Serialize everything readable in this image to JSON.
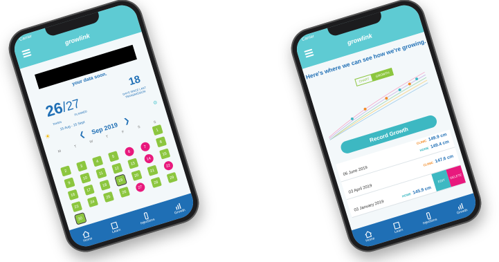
{
  "left_phone": {
    "status": {
      "carrier": "Carrier",
      "time": "",
      "battery": ""
    },
    "logo": "growlink",
    "message": "your data soon.",
    "taken": "26",
    "planned": "27",
    "taken_label": "TAKEN",
    "planned_label": "PLANNED",
    "days_since": "18",
    "days_since_label": "DAYS SINCE LAST TRANSMISSION",
    "range": "15 Aug - 15 Sept",
    "month": "Sep 2019",
    "weekdays": [
      "M",
      "T",
      "W",
      "T",
      "F",
      "S",
      "S"
    ],
    "nav": [
      "Home",
      "Learn",
      "Injections",
      "Growth"
    ]
  },
  "calendar_days": [
    {
      "d": "",
      "s": "e"
    },
    {
      "d": "",
      "s": "e"
    },
    {
      "d": "",
      "s": "e"
    },
    {
      "d": "",
      "s": "e"
    },
    {
      "d": "",
      "s": "e"
    },
    {
      "d": "",
      "s": "e"
    },
    {
      "d": "1",
      "s": "g"
    },
    {
      "d": "2",
      "s": "g"
    },
    {
      "d": "3",
      "s": "g"
    },
    {
      "d": "4",
      "s": "g"
    },
    {
      "d": "5",
      "s": "g"
    },
    {
      "d": "6",
      "s": "p"
    },
    {
      "d": "7",
      "s": "p"
    },
    {
      "d": "8",
      "s": "g"
    },
    {
      "d": "9",
      "s": "g"
    },
    {
      "d": "10",
      "s": "g"
    },
    {
      "d": "11",
      "s": "g"
    },
    {
      "d": "12",
      "s": "g"
    },
    {
      "d": "13",
      "s": "g"
    },
    {
      "d": "14",
      "s": "p"
    },
    {
      "d": "15",
      "s": "g"
    },
    {
      "d": "16",
      "s": "g"
    },
    {
      "d": "17",
      "s": "g"
    },
    {
      "d": "18",
      "s": "g"
    },
    {
      "d": "19",
      "s": "g"
    },
    {
      "d": "20",
      "s": "g"
    },
    {
      "d": "21",
      "s": "g"
    },
    {
      "d": "22",
      "s": "p"
    },
    {
      "d": "23",
      "s": "g"
    },
    {
      "d": "24",
      "s": "g"
    },
    {
      "d": "25",
      "s": "g"
    },
    {
      "d": "26",
      "s": "g"
    },
    {
      "d": "27",
      "s": "p"
    },
    {
      "d": "28",
      "s": "g"
    },
    {
      "d": "29",
      "s": "g"
    },
    {
      "d": "30",
      "s": "g"
    },
    {
      "d": "",
      "s": "e"
    },
    {
      "d": "",
      "s": "e"
    },
    {
      "d": "",
      "s": "e"
    },
    {
      "d": "",
      "s": "e"
    },
    {
      "d": "",
      "s": "e"
    },
    {
      "d": "",
      "s": "e"
    }
  ],
  "right_phone": {
    "status": {
      "carrier": "Carrier"
    },
    "logo": "growlink",
    "headline": "Here's where we can see how we're growing.",
    "toggle": [
      "CHART",
      "GROWTH"
    ],
    "record_button": "Record Growth",
    "rows": [
      {
        "date": "06 June 2019",
        "entries": [
          {
            "src": "CLINIC",
            "val": "149.9 cm",
            "color": "#f28c28"
          },
          {
            "src": "HOME",
            "val": "149.4 cm",
            "color": "#3db8c2"
          }
        ]
      },
      {
        "date": "03 April 2019",
        "entries": [
          {
            "src": "CLINIC",
            "val": "147.6 cm",
            "color": "#f28c28"
          }
        ]
      },
      {
        "date": "03 January 2019",
        "entries": [
          {
            "src": "HOME",
            "val": "145.9 cm",
            "color": "#3db8c2"
          }
        ],
        "actions": [
          "EDIT",
          "DELETE"
        ]
      }
    ],
    "nav": [
      "Home",
      "Learn",
      "Injections",
      "Growth"
    ]
  },
  "colors": {
    "teal": "#5ecbd3",
    "blue": "#1f6fb5",
    "green": "#8cc63f",
    "pink": "#e8197d",
    "orange": "#f28c28"
  }
}
